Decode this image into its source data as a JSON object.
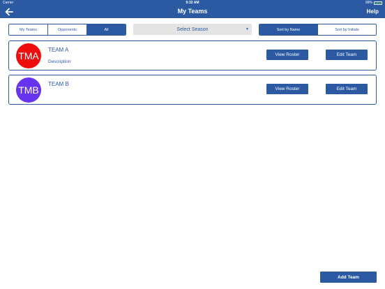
{
  "status_bar": {
    "carrier": "Carrier",
    "time": "9:32 AM",
    "battery": "99%"
  },
  "nav": {
    "title": "My Teams",
    "help_label": "Help",
    "back_icon": "arrow-left-icon"
  },
  "filter_tabs": [
    {
      "label": "My Teams",
      "active": false
    },
    {
      "label": "Opponents",
      "active": false
    },
    {
      "label": "All",
      "active": true
    }
  ],
  "season_select": {
    "value": "Select Season",
    "caret_icon": "triangle-down-icon"
  },
  "sort_tabs": [
    {
      "label": "Sort by Name",
      "active": true
    },
    {
      "label": "Sort by Initials",
      "active": false
    }
  ],
  "teams": [
    {
      "initials": "TMA",
      "name": "TEAM A",
      "description": "Description",
      "avatar_color": "#ee0d0d",
      "view_roster_label": "View Roster",
      "edit_label": "Edit Team"
    },
    {
      "initials": "TMB",
      "name": "TEAM B",
      "description": "",
      "avatar_color": "#6633ee",
      "view_roster_label": "View Roster",
      "edit_label": "Edit Team"
    }
  ],
  "add_team_label": "Add Team",
  "colors": {
    "primary": "#2b5aa3",
    "season_bg": "#e4e4e4"
  }
}
